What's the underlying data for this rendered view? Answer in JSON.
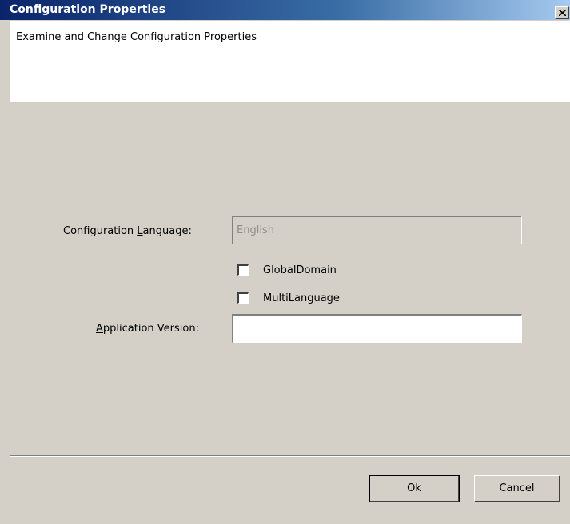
{
  "window": {
    "title": "Configuration Properties",
    "close_icon": "close-icon"
  },
  "header": {
    "subtitle": "Examine and Change Configuration Properties"
  },
  "form": {
    "language_label_pre": "Configuration ",
    "language_label_accel": "L",
    "language_label_post": "anguage:",
    "language_value": "English",
    "global_domain_label": "GlobalDomain",
    "global_domain_checked": false,
    "multi_language_label": "MultiLanguage",
    "multi_language_checked": false,
    "version_label_accel": "A",
    "version_label_post": "pplication Version:",
    "version_value": ""
  },
  "buttons": {
    "ok_label": "Ok",
    "cancel_label": "Cancel"
  }
}
